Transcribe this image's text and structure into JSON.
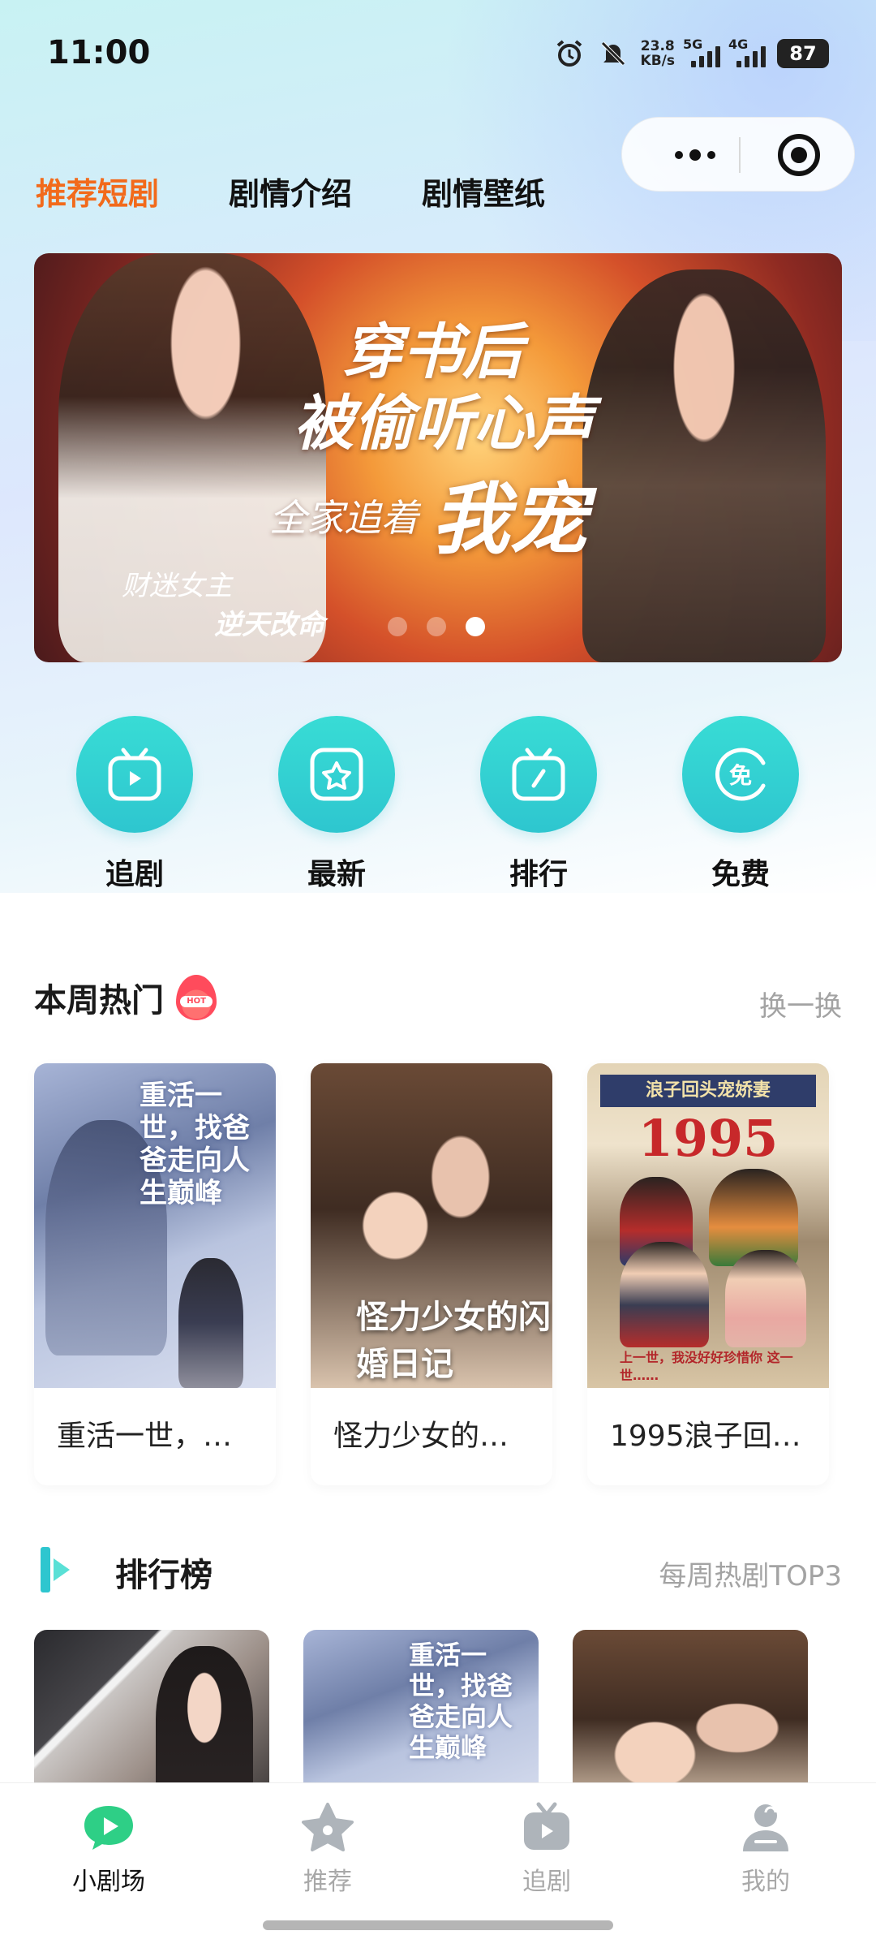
{
  "status_bar": {
    "time": "11:00",
    "net_speed_value": "23.8",
    "net_speed_unit": "KB/s",
    "signal1_label": "5G",
    "signal2_label": "4G",
    "battery": "87"
  },
  "capsule": {
    "more_icon": "more-dots-icon",
    "close_icon": "target-circle-icon"
  },
  "tabs": [
    {
      "label": "推荐短剧",
      "active": true
    },
    {
      "label": "剧情介绍",
      "active": false
    },
    {
      "label": "剧情壁纸",
      "active": false
    }
  ],
  "banner": {
    "line1": "穿书后",
    "line2": "被偷听心声",
    "line3": "全家追着",
    "line4": "我宠",
    "tag1": "财迷女主",
    "tag2": "逆天改命",
    "page_count": 3,
    "active_page": 3
  },
  "quick_nav": [
    {
      "label": "追剧",
      "icon": "tv-play-icon"
    },
    {
      "label": "最新",
      "icon": "star-square-icon"
    },
    {
      "label": "排行",
      "icon": "tv-rank-icon"
    },
    {
      "label": "免费",
      "icon": "free-badge-icon",
      "glyph": "免"
    }
  ],
  "hot_section": {
    "title": "本周热门",
    "badge": "HOT",
    "action": "换一换",
    "items": [
      {
        "title": "重活一世，…",
        "poster_text": "重活一世，找爸爸走向人生巅峰"
      },
      {
        "title": "怪力少女的…",
        "poster_text": "怪力少女的闪婚日记"
      },
      {
        "title": "1995浪子回…",
        "poster_head": "浪子回头宠娇妻",
        "poster_year": "1995",
        "poster_foot": "上一世，我没好好珍惜你 这一世……"
      }
    ]
  },
  "rank_section": {
    "title": "排行榜",
    "subtitle": "每周热剧TOP3",
    "items": [
      {
        "poster_text": ""
      },
      {
        "poster_text": "重活一世，找爸爸走向人生巅峰"
      },
      {
        "poster_text": ""
      }
    ]
  },
  "bottom_nav": [
    {
      "label": "小剧场",
      "icon": "theater-icon",
      "active": true
    },
    {
      "label": "推荐",
      "icon": "star-icon",
      "active": false
    },
    {
      "label": "追剧",
      "icon": "tv-icon",
      "active": false
    },
    {
      "label": "我的",
      "icon": "profile-icon",
      "active": false
    }
  ],
  "colors": {
    "accent": "#f26a1b",
    "teal": "#2ec6cf",
    "muted": "#a3a3a3"
  }
}
